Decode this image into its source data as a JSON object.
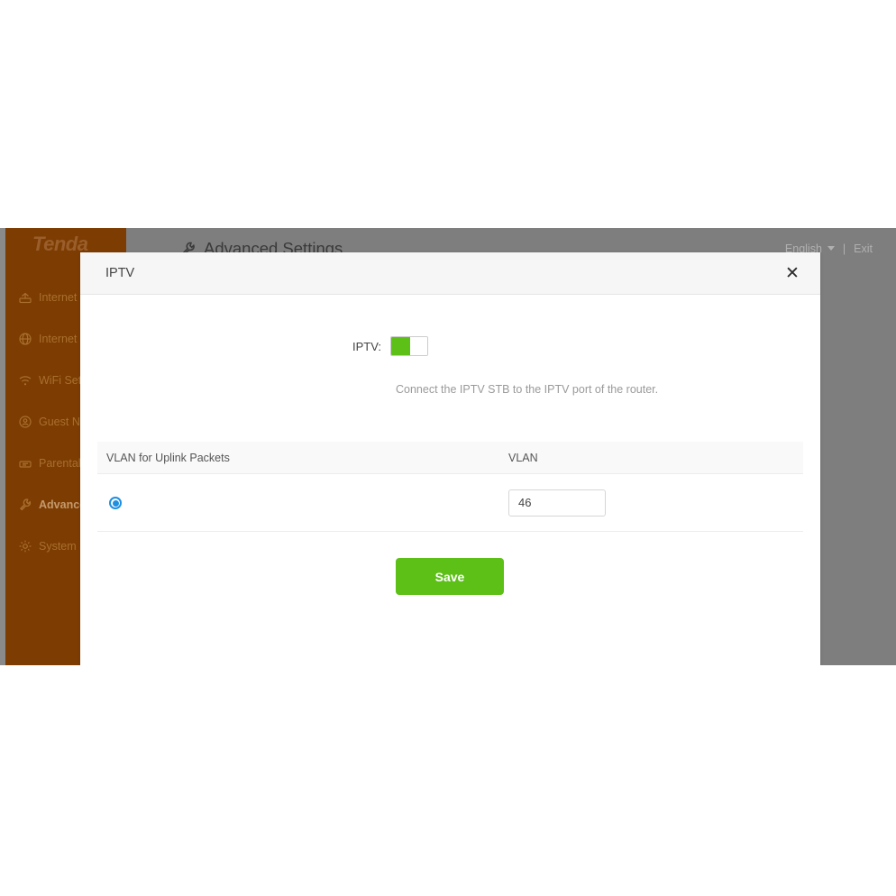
{
  "colors": {
    "sidebar_bg": "#7d3c02",
    "accent_green": "#5cc017",
    "radio_blue": "#1f8fe0",
    "header_gray": "#7e7e7e",
    "modal_header_bg": "#f6f6f6"
  },
  "sidebar": {
    "logo": "Tenda",
    "items": [
      {
        "label": "Internet St",
        "icon": "router-icon",
        "active": false
      },
      {
        "label": "Internet Se",
        "icon": "globe-icon",
        "active": false
      },
      {
        "label": "WiFi Settin",
        "icon": "wifi-icon",
        "active": false
      },
      {
        "label": "Guest Net",
        "icon": "guest-network-icon",
        "active": false
      },
      {
        "label": "Parental C",
        "icon": "parental-control-icon",
        "active": false
      },
      {
        "label": "Advanced",
        "icon": "wrench-icon",
        "active": true
      },
      {
        "label": "System Se",
        "icon": "gear-icon",
        "active": false
      }
    ]
  },
  "topbar": {
    "title": "Advanced Settings",
    "title_icon": "wrench-icon",
    "language": "English",
    "separator": "|",
    "exit": "Exit"
  },
  "modal": {
    "title": "IPTV",
    "close_label": "✕",
    "iptv": {
      "label": "IPTV:",
      "enabled": true,
      "hint": "Connect the IPTV STB to the IPTV port of the router."
    },
    "table": {
      "headers": [
        "VLAN for Uplink Packets",
        "VLAN"
      ],
      "rows": [
        {
          "selected": true,
          "vlan": "46"
        }
      ]
    },
    "save_label": "Save"
  }
}
